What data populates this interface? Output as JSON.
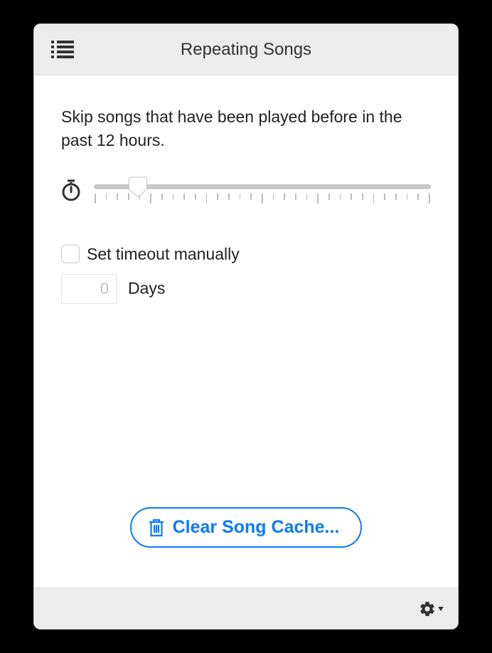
{
  "header": {
    "title": "Repeating Songs"
  },
  "description": "Skip songs that have been played before in the past 12 hours.",
  "slider": {
    "position_percent": 13,
    "tick_count": 31
  },
  "manual": {
    "checkbox_label": "Set timeout manually",
    "checked": false,
    "value": "0",
    "unit_label": "Days"
  },
  "clear_button": {
    "label": "Clear Song Cache..."
  }
}
